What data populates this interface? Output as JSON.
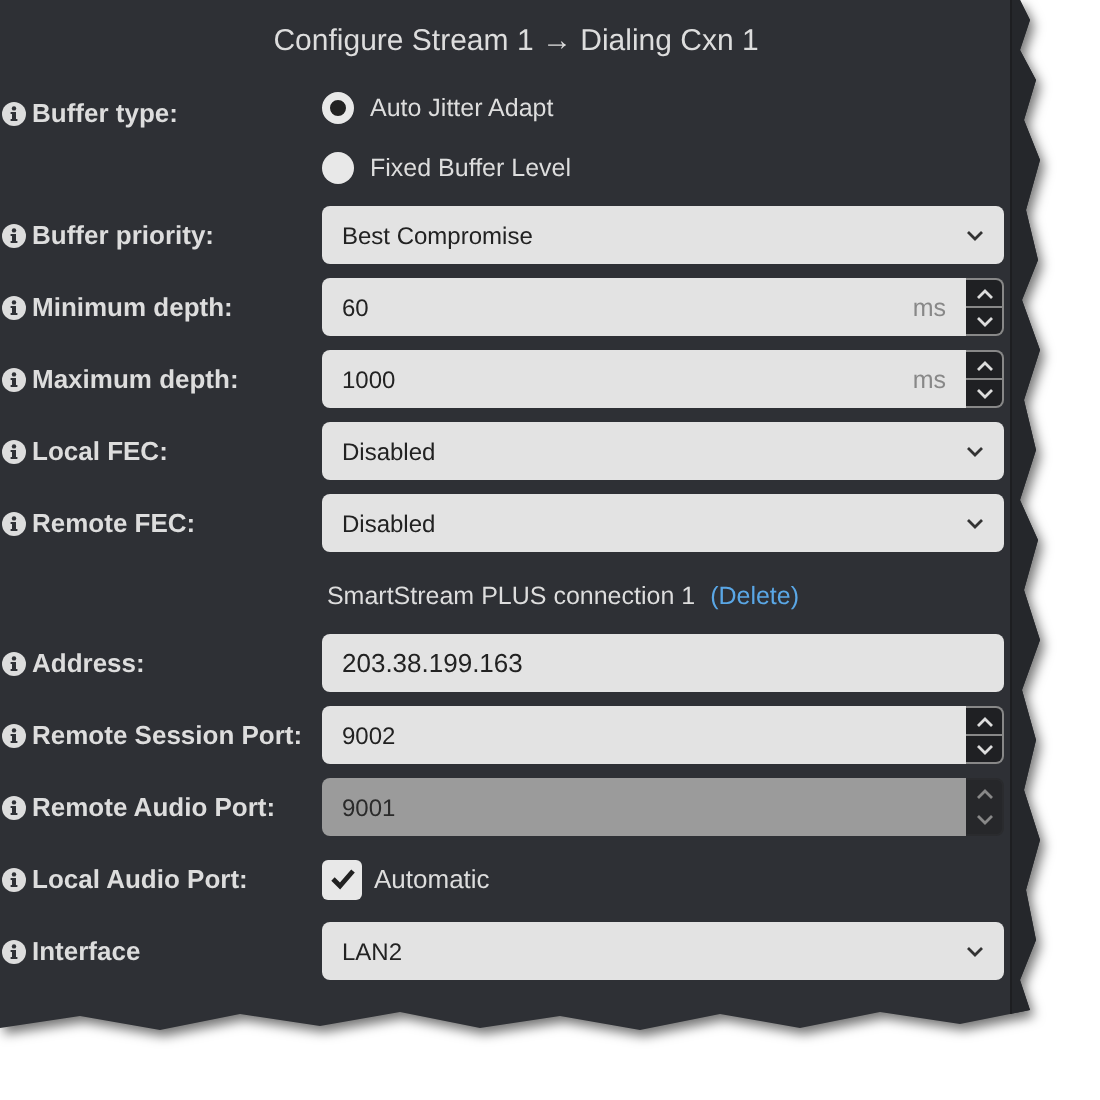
{
  "title": "Configure Stream 1 → Dialing Cxn 1",
  "rows": [
    {
      "kind": "radio",
      "label": "Buffer type:",
      "options": [
        {
          "label": "Auto Jitter Adapt",
          "selected": true
        },
        {
          "label": "Fixed Buffer Level",
          "selected": false
        }
      ]
    },
    {
      "kind": "select",
      "label": "Buffer priority:",
      "value": "Best Compromise"
    },
    {
      "kind": "spinner",
      "label": "Minimum depth:",
      "value": "60",
      "unit": "ms",
      "disabled": false
    },
    {
      "kind": "spinner",
      "label": "Maximum depth:",
      "value": "1000",
      "unit": "ms",
      "disabled": false
    },
    {
      "kind": "select",
      "label": "Local FEC:",
      "value": "Disabled"
    },
    {
      "kind": "select",
      "label": "Remote FEC:",
      "value": "Disabled"
    },
    {
      "kind": "heading",
      "text": "SmartStream PLUS connection 1",
      "link": "(Delete)"
    },
    {
      "kind": "text",
      "label": "Address:",
      "value": "203.38.199.163"
    },
    {
      "kind": "spinner",
      "label": "Remote Session Port:",
      "value": "9002",
      "disabled": false
    },
    {
      "kind": "spinner",
      "label": "Remote Audio Port:",
      "value": "9001",
      "disabled": true
    },
    {
      "kind": "checkbox",
      "label": "Local Audio Port:",
      "text": "Automatic",
      "checked": true
    },
    {
      "kind": "select",
      "label": "Interface",
      "value": "LAN2"
    }
  ]
}
